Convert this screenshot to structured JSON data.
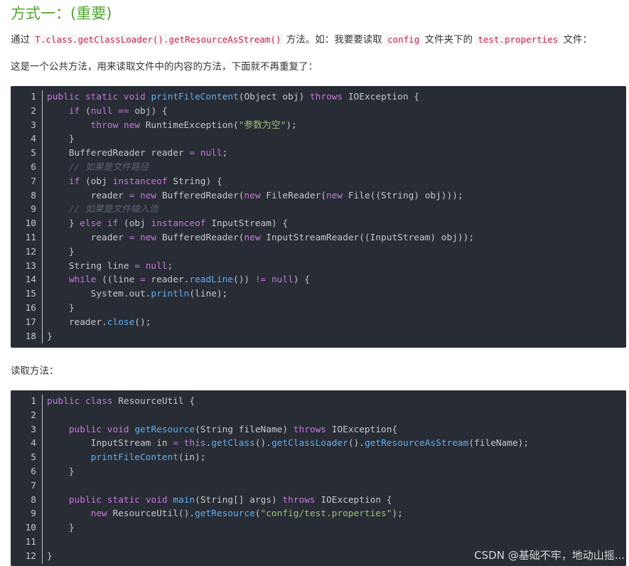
{
  "heading": "方式一：(重要)",
  "para1": {
    "t1": "通过 ",
    "code1": "T.class.getClassLoader().getResourceAsStream()",
    "t2": " 方法。如：我要要读取 ",
    "code2": "config",
    "t3": " 文件夹下的 ",
    "code3": "test.properties",
    "t4": " 文件："
  },
  "para2": "这是一个公共方法，用来读取文件中的内容的方法，下面就不再重复了：",
  "para3": "读取方法：",
  "colors": {
    "heading": "#4ea72e",
    "code_bg": "#282c34",
    "keyword": "#c678dd",
    "function": "#61afef",
    "string": "#98c379",
    "comment": "#5c6370",
    "inline_code": "#c7254e"
  },
  "code_block_1": [
    [
      [
        "kw",
        "public"
      ],
      [
        "t",
        " "
      ],
      [
        "kw",
        "static"
      ],
      [
        "t",
        " "
      ],
      [
        "kw",
        "void"
      ],
      [
        "t",
        " "
      ],
      [
        "fn",
        "printFileContent"
      ],
      [
        "t",
        "(Object obj) "
      ],
      [
        "kw",
        "throws"
      ],
      [
        "t",
        " IOException {"
      ]
    ],
    [
      [
        "t",
        "    "
      ],
      [
        "kw",
        "if"
      ],
      [
        "t",
        " ("
      ],
      [
        "kw",
        "null"
      ],
      [
        "t",
        " "
      ],
      [
        "kw",
        "=="
      ],
      [
        "t",
        " obj) {"
      ]
    ],
    [
      [
        "t",
        "        "
      ],
      [
        "kw",
        "throw"
      ],
      [
        "t",
        " "
      ],
      [
        "kw",
        "new"
      ],
      [
        "t",
        " RuntimeException("
      ],
      [
        "str",
        "\"参数为空\""
      ],
      [
        "t",
        ");"
      ]
    ],
    [
      [
        "t",
        "    }"
      ]
    ],
    [
      [
        "t",
        "    BufferedReader reader "
      ],
      [
        "kw",
        "="
      ],
      [
        "t",
        " "
      ],
      [
        "kw",
        "null"
      ],
      [
        "t",
        ";"
      ]
    ],
    [
      [
        "t",
        "    "
      ],
      [
        "cm",
        "// 如果是文件路径"
      ]
    ],
    [
      [
        "t",
        "    "
      ],
      [
        "kw",
        "if"
      ],
      [
        "t",
        " (obj "
      ],
      [
        "kw",
        "instanceof"
      ],
      [
        "t",
        " String) {"
      ]
    ],
    [
      [
        "t",
        "        reader "
      ],
      [
        "kw",
        "="
      ],
      [
        "t",
        " "
      ],
      [
        "kw",
        "new"
      ],
      [
        "t",
        " BufferedReader("
      ],
      [
        "kw",
        "new"
      ],
      [
        "t",
        " FileReader("
      ],
      [
        "kw",
        "new"
      ],
      [
        "t",
        " File((String) obj)));"
      ]
    ],
    [
      [
        "t",
        "    "
      ],
      [
        "cm",
        "// 如果是文件输入流"
      ]
    ],
    [
      [
        "t",
        "    } "
      ],
      [
        "kw",
        "else"
      ],
      [
        "t",
        " "
      ],
      [
        "kw",
        "if"
      ],
      [
        "t",
        " (obj "
      ],
      [
        "kw",
        "instanceof"
      ],
      [
        "t",
        " InputStream) {"
      ]
    ],
    [
      [
        "t",
        "        reader "
      ],
      [
        "kw",
        "="
      ],
      [
        "t",
        " "
      ],
      [
        "kw",
        "new"
      ],
      [
        "t",
        " BufferedReader("
      ],
      [
        "kw",
        "new"
      ],
      [
        "t",
        " InputStreamReader((InputStream) obj));"
      ]
    ],
    [
      [
        "t",
        "    }"
      ]
    ],
    [
      [
        "t",
        "    String line "
      ],
      [
        "kw",
        "="
      ],
      [
        "t",
        " "
      ],
      [
        "kw",
        "null"
      ],
      [
        "t",
        ";"
      ]
    ],
    [
      [
        "t",
        "    "
      ],
      [
        "kw",
        "while"
      ],
      [
        "t",
        " ((line "
      ],
      [
        "kw",
        "="
      ],
      [
        "t",
        " reader."
      ],
      [
        "fn",
        "readLine"
      ],
      [
        "t",
        "()) "
      ],
      [
        "kw",
        "!="
      ],
      [
        "t",
        " "
      ],
      [
        "kw",
        "null"
      ],
      [
        "t",
        ") {"
      ]
    ],
    [
      [
        "t",
        "        System.out."
      ],
      [
        "fn",
        "println"
      ],
      [
        "t",
        "(line);"
      ]
    ],
    [
      [
        "t",
        "    }"
      ]
    ],
    [
      [
        "t",
        "    reader."
      ],
      [
        "fn",
        "close"
      ],
      [
        "t",
        "();"
      ]
    ],
    [
      [
        "t",
        "}"
      ]
    ]
  ],
  "code_block_2": [
    [
      [
        "kw",
        "public"
      ],
      [
        "t",
        " "
      ],
      [
        "kw",
        "class"
      ],
      [
        "t",
        " ResourceUtil {"
      ]
    ],
    [
      [
        "t",
        ""
      ]
    ],
    [
      [
        "t",
        "    "
      ],
      [
        "kw",
        "public"
      ],
      [
        "t",
        " "
      ],
      [
        "kw",
        "void"
      ],
      [
        "t",
        " "
      ],
      [
        "fn",
        "getResource"
      ],
      [
        "t",
        "(String fileName) "
      ],
      [
        "kw",
        "throws"
      ],
      [
        "t",
        " IOException{"
      ]
    ],
    [
      [
        "t",
        "        InputStream in "
      ],
      [
        "kw",
        "="
      ],
      [
        "t",
        " "
      ],
      [
        "kw",
        "this"
      ],
      [
        "t",
        "."
      ],
      [
        "fn",
        "getClass"
      ],
      [
        "t",
        "()."
      ],
      [
        "fn",
        "getClassLoader"
      ],
      [
        "t",
        "()."
      ],
      [
        "fn",
        "getResourceAsStream"
      ],
      [
        "t",
        "(fileName);"
      ]
    ],
    [
      [
        "t",
        "        "
      ],
      [
        "fn",
        "printFileContent"
      ],
      [
        "t",
        "(in);"
      ]
    ],
    [
      [
        "t",
        "    }"
      ]
    ],
    [
      [
        "t",
        ""
      ]
    ],
    [
      [
        "t",
        "    "
      ],
      [
        "kw",
        "public"
      ],
      [
        "t",
        " "
      ],
      [
        "kw",
        "static"
      ],
      [
        "t",
        " "
      ],
      [
        "kw",
        "void"
      ],
      [
        "t",
        " "
      ],
      [
        "fn",
        "main"
      ],
      [
        "t",
        "(String[] args) "
      ],
      [
        "kw",
        "throws"
      ],
      [
        "t",
        " IOException {"
      ]
    ],
    [
      [
        "t",
        "        "
      ],
      [
        "kw",
        "new"
      ],
      [
        "t",
        " ResourceUtil()."
      ],
      [
        "fn",
        "getResource"
      ],
      [
        "t",
        "("
      ],
      [
        "str",
        "\"config/test.properties\""
      ],
      [
        "t",
        ");"
      ]
    ],
    [
      [
        "t",
        "    }"
      ]
    ],
    [
      [
        "t",
        ""
      ]
    ],
    [
      [
        "t",
        "}"
      ]
    ]
  ],
  "watermark": "CSDN @基础不牢，地动山摇..."
}
